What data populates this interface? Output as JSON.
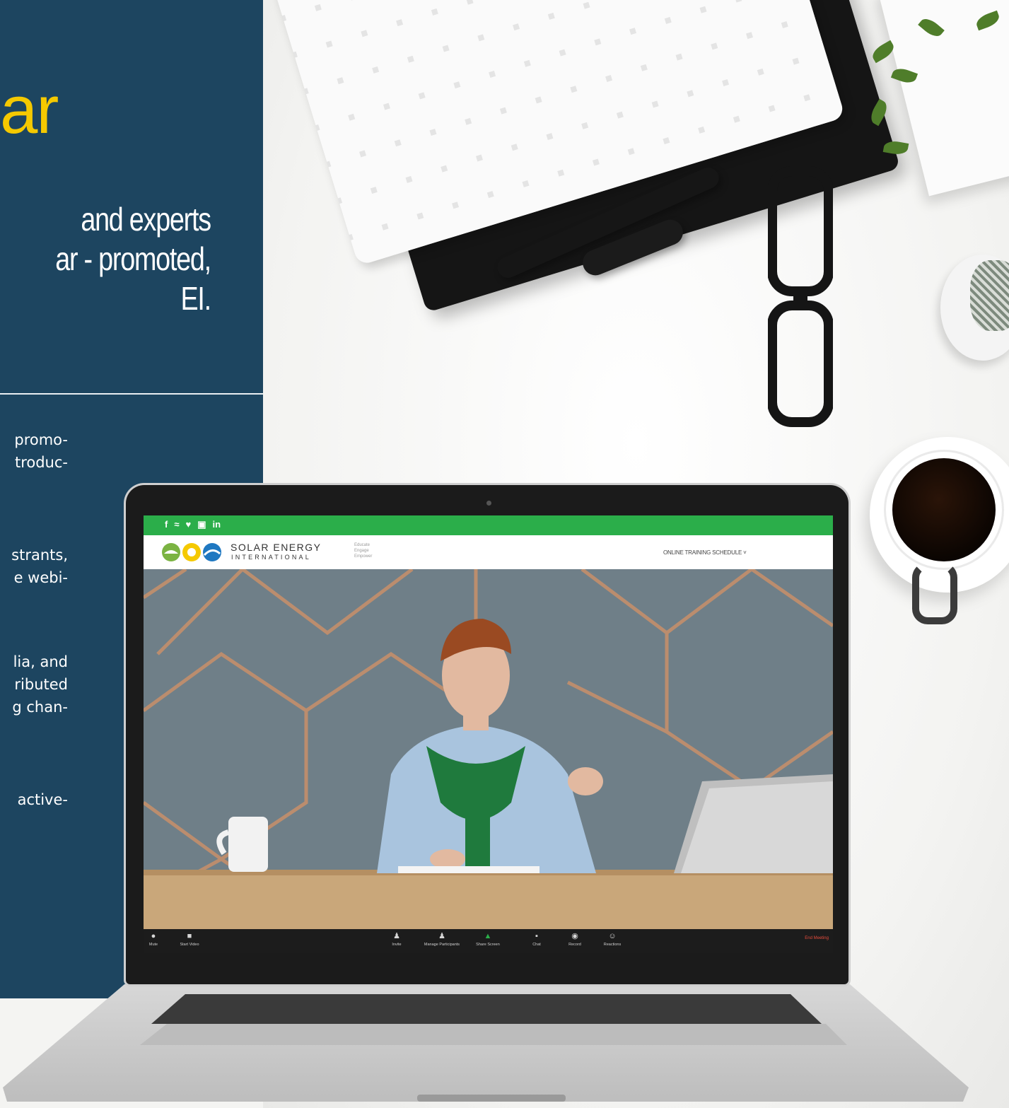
{
  "panel": {
    "headline": "ar",
    "subhead_lines": [
      "and experts",
      "ar - promoted,",
      "EI."
    ],
    "body_fragments": [
      [
        "promo-",
        "troduc-"
      ],
      [
        "strants,",
        "e webi-"
      ],
      [
        "lia,  and",
        "ributed",
        "g chan-"
      ],
      [
        "active-"
      ]
    ]
  },
  "website": {
    "social_icons": [
      "facebook-icon",
      "rss-icon",
      "twitter-icon",
      "youtube-icon",
      "linkedin-icon"
    ],
    "social_glyphs": [
      "f",
      "≈",
      "♥",
      "▣",
      "in"
    ],
    "logo_line1": "SOLAR ENERGY",
    "logo_line2": "INTERNATIONAL",
    "tagline": [
      "Educate",
      "Engage",
      "Empower"
    ],
    "schedule_link": "ONLINE TRAINING SCHEDULE ˅",
    "accent_color": "#2bae4a"
  },
  "zoom": {
    "controls": [
      {
        "label": "Mute",
        "icon": "microphone-icon"
      },
      {
        "label": "Start Video",
        "icon": "camera-icon"
      },
      {
        "label": "Invite",
        "icon": "invite-icon"
      },
      {
        "label": "Manage Participants",
        "icon": "participants-icon"
      },
      {
        "label": "Share Screen",
        "icon": "share-screen-icon"
      },
      {
        "label": "Chat",
        "icon": "chat-icon"
      },
      {
        "label": "Record",
        "icon": "record-icon"
      },
      {
        "label": "Reactions",
        "icon": "reactions-icon"
      }
    ],
    "end_meeting": "End Meeting",
    "participant_count": "1"
  },
  "colors": {
    "panel_bg": "#1d4560",
    "headline": "#f5c900",
    "end_meeting": "#e74c3c"
  }
}
